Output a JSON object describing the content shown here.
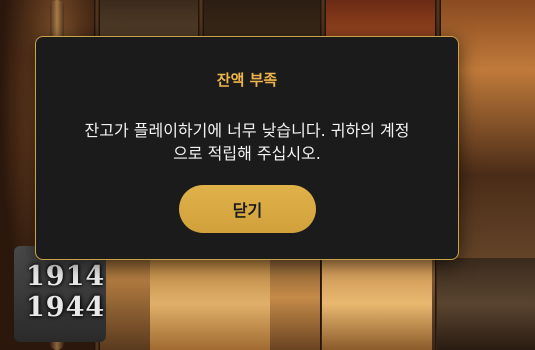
{
  "modal": {
    "title": "잔액 부족",
    "message": "잔고가 플레이하기에 너무 낮습니다. 귀하의 계정\n으로 적립해 주십시오.",
    "close_label": "닫기"
  },
  "background": {
    "year_top": "1914",
    "year_bottom": "1944"
  },
  "colors": {
    "accent": "#f0b54a",
    "button": "#d9a843",
    "modal_bg": "#1b1b1b",
    "border": "#c9a24a"
  }
}
